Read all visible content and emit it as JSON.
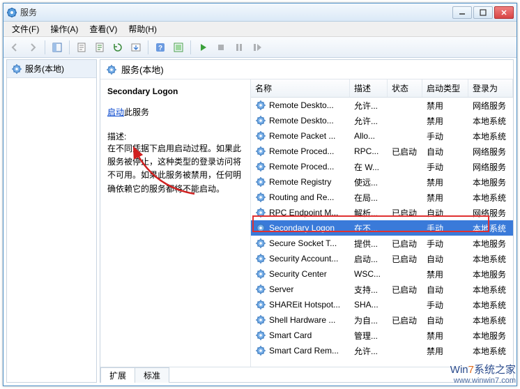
{
  "window": {
    "title": "服务"
  },
  "menu": {
    "file": "文件(F)",
    "action": "操作(A)",
    "view": "查看(V)",
    "help": "帮助(H)"
  },
  "left": {
    "root": "服务(本地)"
  },
  "right": {
    "header": "服务(本地)",
    "selected_title": "Secondary Logon",
    "start_link": "启动",
    "start_suffix": "此服务",
    "desc_label": "描述:",
    "desc_text": "在不同凭据下启用启动过程。如果此服务被停止，这种类型的登录访问将不可用。如果此服务被禁用，任何明确依赖它的服务都将不能启动。"
  },
  "columns": {
    "name": "名称",
    "desc": "描述",
    "status": "状态",
    "startup": "启动类型",
    "logon": "登录为"
  },
  "tabs": {
    "extended": "扩展",
    "standard": "标准"
  },
  "services": [
    {
      "name": "Remote Deskto...",
      "desc": "允许...",
      "status": "",
      "startup": "禁用",
      "logon": "网络服务"
    },
    {
      "name": "Remote Deskto...",
      "desc": "允许...",
      "status": "",
      "startup": "禁用",
      "logon": "本地系统"
    },
    {
      "name": "Remote Packet ...",
      "desc": "Allo...",
      "status": "",
      "startup": "手动",
      "logon": "本地系统"
    },
    {
      "name": "Remote Proced...",
      "desc": "RPC...",
      "status": "已启动",
      "startup": "自动",
      "logon": "网络服务"
    },
    {
      "name": "Remote Proced...",
      "desc": "在 W...",
      "status": "",
      "startup": "手动",
      "logon": "网络服务"
    },
    {
      "name": "Remote Registry",
      "desc": "使远...",
      "status": "",
      "startup": "禁用",
      "logon": "本地服务"
    },
    {
      "name": "Routing and Re...",
      "desc": "在局...",
      "status": "",
      "startup": "禁用",
      "logon": "本地系统"
    },
    {
      "name": "RPC Endpoint M...",
      "desc": "解析...",
      "status": "已启动",
      "startup": "自动",
      "logon": "网络服务"
    },
    {
      "name": "Secondary Logon",
      "desc": "在不...",
      "status": "",
      "startup": "手动",
      "logon": "本地系统",
      "selected": true
    },
    {
      "name": "Secure Socket T...",
      "desc": "提供...",
      "status": "已启动",
      "startup": "手动",
      "logon": "本地服务"
    },
    {
      "name": "Security Account...",
      "desc": "启动...",
      "status": "已启动",
      "startup": "自动",
      "logon": "本地系统"
    },
    {
      "name": "Security Center",
      "desc": "WSC...",
      "status": "",
      "startup": "禁用",
      "logon": "本地服务"
    },
    {
      "name": "Server",
      "desc": "支持...",
      "status": "已启动",
      "startup": "自动",
      "logon": "本地系统"
    },
    {
      "name": "SHAREit Hotspot...",
      "desc": "SHA...",
      "status": "",
      "startup": "手动",
      "logon": "本地系统"
    },
    {
      "name": "Shell Hardware ...",
      "desc": "为自...",
      "status": "已启动",
      "startup": "自动",
      "logon": "本地系统"
    },
    {
      "name": "Smart Card",
      "desc": "管理...",
      "status": "",
      "startup": "禁用",
      "logon": "本地服务"
    },
    {
      "name": "Smart Card Rem...",
      "desc": "允许...",
      "status": "",
      "startup": "禁用",
      "logon": "本地系统"
    }
  ],
  "watermark": {
    "line1a": "Win",
    "line1b": "7",
    "line1c": "系统之家",
    "line2": "www.winwin7.com"
  }
}
